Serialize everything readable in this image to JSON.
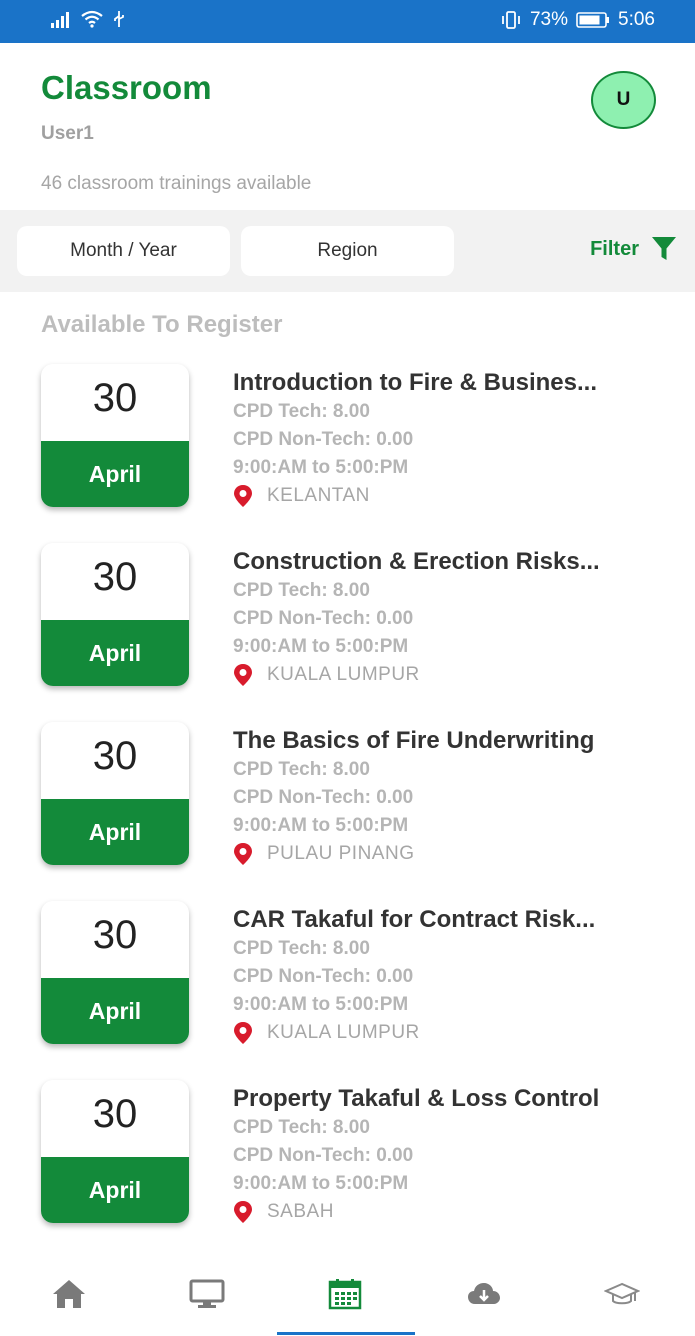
{
  "status_bar": {
    "battery": "73%",
    "time": "5:06"
  },
  "header": {
    "title": "Classroom",
    "user": "User1",
    "avatar_initial": "U",
    "count_text": "46 classroom trainings available"
  },
  "filters": {
    "month_year": "Month / Year",
    "region": "Region",
    "filter_label": "Filter"
  },
  "section_title": "Available To Register",
  "trainings": [
    {
      "day": "30",
      "month": "April",
      "title": "Introduction to Fire & Busines...",
      "cpd_tech": "CPD Tech: 8.00",
      "cpd_nontech": "CPD Non-Tech: 0.00",
      "time": "9:00:AM to 5:00:PM",
      "location": "KELANTAN"
    },
    {
      "day": "30",
      "month": "April",
      "title": "Construction & Erection Risks...",
      "cpd_tech": "CPD Tech: 8.00",
      "cpd_nontech": "CPD Non-Tech: 0.00",
      "time": "9:00:AM to 5:00:PM",
      "location": "KUALA LUMPUR"
    },
    {
      "day": "30",
      "month": "April",
      "title": "The Basics of Fire Underwriting",
      "cpd_tech": "CPD Tech: 8.00",
      "cpd_nontech": "CPD Non-Tech: 0.00",
      "time": "9:00:AM to 5:00:PM",
      "location": "PULAU PINANG"
    },
    {
      "day": "30",
      "month": "April",
      "title": "CAR Takaful for Contract Risk...",
      "cpd_tech": "CPD Tech: 8.00",
      "cpd_nontech": "CPD Non-Tech: 0.00",
      "time": "9:00:AM to 5:00:PM",
      "location": "KUALA LUMPUR"
    },
    {
      "day": "30",
      "month": "April",
      "title": "Property Takaful &  Loss Control",
      "cpd_tech": "CPD Tech: 8.00",
      "cpd_nontech": "CPD Non-Tech: 0.00",
      "time": "9:00:AM to 5:00:PM",
      "location": "SABAH"
    }
  ],
  "colors": {
    "accent": "#138a3a",
    "statusbar": "#1a73c8",
    "avatar_bg": "#8ef0b0",
    "pin": "#d81b2c"
  },
  "bottom_nav": [
    {
      "icon": "home-icon",
      "active": false
    },
    {
      "icon": "monitor-icon",
      "active": false
    },
    {
      "icon": "calendar-icon",
      "active": true
    },
    {
      "icon": "cloud-download-icon",
      "active": false
    },
    {
      "icon": "graduation-cap-icon",
      "active": false
    }
  ]
}
